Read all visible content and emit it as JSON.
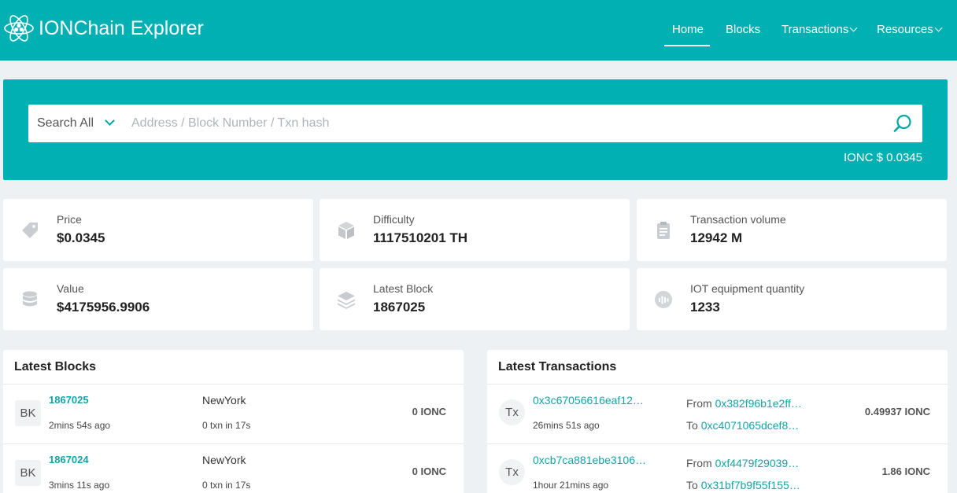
{
  "header": {
    "brand": "IONChain Explorer",
    "nav": [
      {
        "label": "Home"
      },
      {
        "label": "Blocks"
      },
      {
        "label": "Transactions"
      },
      {
        "label": "Resources"
      }
    ]
  },
  "search": {
    "scope": "Search All",
    "placeholder": "Address / Block Number / Txn hash",
    "value": ""
  },
  "price_tag": "IONC $ 0.0345",
  "stats": [
    {
      "label": "Price",
      "value": "$0.0345",
      "icon": "tag-icon"
    },
    {
      "label": "Difficulty",
      "value": "1117510201 TH",
      "icon": "cube-icon"
    },
    {
      "label": "Transaction volume",
      "value": "12942 M",
      "icon": "clipboard-icon"
    },
    {
      "label": "Value",
      "value": "$4175956.9906",
      "icon": "database-icon"
    },
    {
      "label": "Latest Block",
      "value": "1867025",
      "icon": "layers-icon"
    },
    {
      "label": "IOT equipment quantity",
      "value": "1233",
      "icon": "signal-icon"
    }
  ],
  "latest_blocks": {
    "title": "Latest Blocks",
    "rows": [
      {
        "badge": "BK",
        "number": "1867025",
        "age": "2mins 54s ago",
        "miner": "NewYork",
        "txn": "0 txn in 17s",
        "amount": "0 IONC"
      },
      {
        "badge": "BK",
        "number": "1867024",
        "age": "3mins 11s ago",
        "miner": "NewYork",
        "txn": "0 txn in 17s",
        "amount": "0 IONC"
      }
    ]
  },
  "latest_transactions": {
    "title": "Latest Transactions",
    "from_label": "From",
    "to_label": "To",
    "rows": [
      {
        "badge": "Tx",
        "hash": "0x3c67056616eaf12…",
        "age": "26mins 51s ago",
        "from": "0x382f96b1e2ff…",
        "to": "0xc4071065dcef8…",
        "amount": "0.49937 IONC"
      },
      {
        "badge": "Tx",
        "hash": "0xcb7ca881ebe3106…",
        "age": "1hour 21mins ago",
        "from": "0xf4479f29039…",
        "to": "0x31bf7b9f55f155…",
        "amount": "1.86 IONC"
      }
    ]
  },
  "colors": {
    "brand": "#00b0b2",
    "link": "#12a4a6",
    "background": "#eef1f4"
  }
}
